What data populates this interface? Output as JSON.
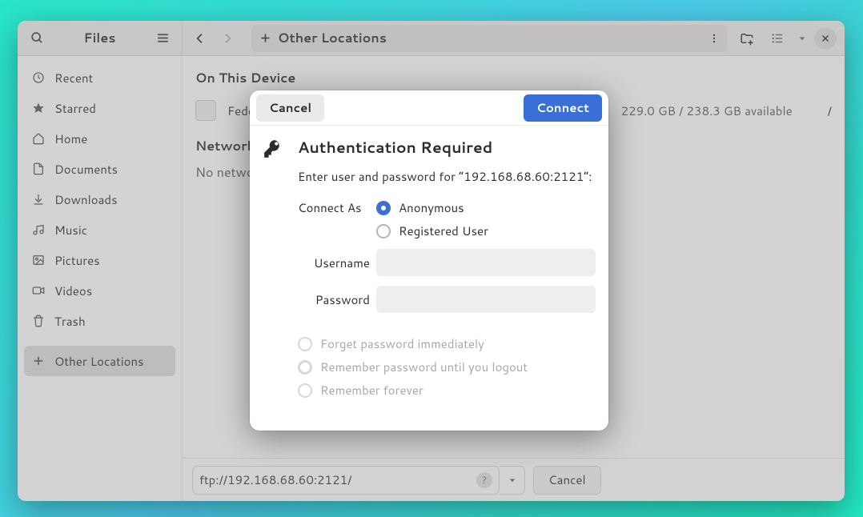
{
  "header": {
    "app_title": "Files",
    "path_label": "Other Locations"
  },
  "sidebar": {
    "items": [
      {
        "label": "Recent"
      },
      {
        "label": "Starred"
      },
      {
        "label": "Home"
      },
      {
        "label": "Documents"
      },
      {
        "label": "Downloads"
      },
      {
        "label": "Music"
      },
      {
        "label": "Pictures"
      },
      {
        "label": "Videos"
      },
      {
        "label": "Trash"
      },
      {
        "label": "Other Locations"
      }
    ]
  },
  "main": {
    "section_device": "On This Device",
    "disk_name": "Fedora Linux",
    "disk_avail": "229.0 GB / 238.3 GB available",
    "disk_mount": "/",
    "section_networks": "Networks",
    "no_networks": "No networks found"
  },
  "bottom": {
    "address": "ftp://192.168.68.60:2121/",
    "cancel": "Cancel"
  },
  "dialog": {
    "cancel": "Cancel",
    "connect": "Connect",
    "title": "Authentication Required",
    "subtitle": "Enter user and password for “192.168.68.60:2121”:",
    "connect_as": "Connect As",
    "opt_anonymous": "Anonymous",
    "opt_registered": "Registered User",
    "username_label": "Username",
    "password_label": "Password",
    "forget": "Forget password immediately",
    "remember_logout": "Remember password until you logout",
    "remember_forever": "Remember forever"
  }
}
